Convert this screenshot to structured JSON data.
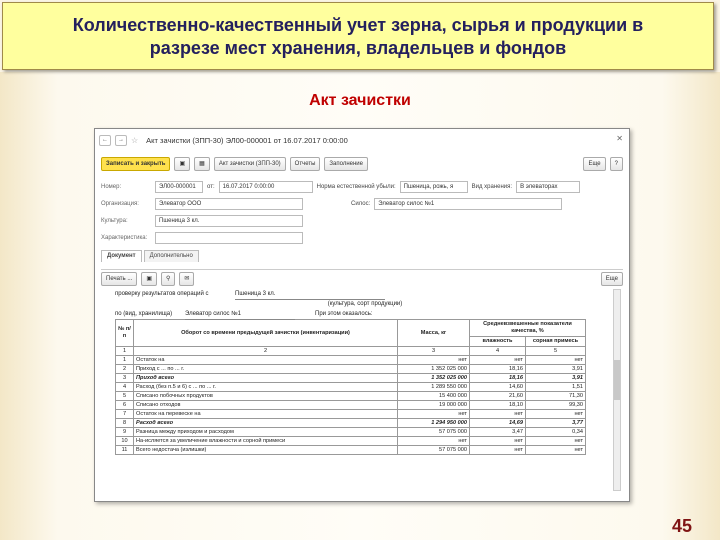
{
  "slide": {
    "title_line1": "Количественно-качественный учет зерна, сырья и продукции в",
    "title_line2": "разрезе мест хранения, владельцев и фондов",
    "heading": "Акт зачистки",
    "page_number": "45"
  },
  "window": {
    "title": "Акт зачистки (ЗПП-30) ЭЛ00-000001 от 16.07.2017 0:00:00",
    "toolbar": {
      "save_close": "Записать и закрыть",
      "print_act": "Акт зачистки (ЗПП-30)",
      "reports": "Отчеты",
      "fill": "Заполнение",
      "more": "Еще",
      "help": "?"
    },
    "fields": {
      "number_label": "Номер:",
      "number_value": "ЭЛ00-000001",
      "date_label": "от:",
      "date_value": "16.07.2017 0:00:00",
      "norm_label": "Норма естественной убыли:",
      "norm_value": "Пшеница, рожь, я",
      "storage_type_label": "Вид хранения:",
      "storage_type_value": "В элеваторах",
      "org_label": "Организация:",
      "org_value": "Элеватор ООО",
      "silo_label": "Силос:",
      "silo_value": "Элеватор силос №1",
      "culture_label": "Культура:",
      "culture_value": "Пшеница 3 кл.",
      "char_label": "Характеристика:",
      "char_value": ""
    },
    "tabs": [
      "Документ",
      "Дополнительно"
    ],
    "doc_toolbar": {
      "print": "Печать ...",
      "more": "Еще"
    },
    "report": {
      "check_label": "проверку результатов операций с",
      "check_value": "Пшеница 3 кл.",
      "culture_caption": "(культура, сорт продукции)",
      "place_label": "по (вид, хранилища)",
      "place_value": "Элеватор силос №1",
      "found_label": "При этом оказалось:",
      "headers": {
        "num": "№ п/п",
        "turnover": "Оборот со времени предыдущей зачистки (инвентаризации)",
        "mass": "Масса, кг",
        "quality": "Средневзвешенные показатели качества, %",
        "moisture": "влажность",
        "weed": "сорная примесь"
      },
      "col_numbers": [
        "1",
        "2",
        "3",
        "4",
        "5"
      ],
      "rows": [
        {
          "n": "1",
          "name": "Остаток на",
          "mass": "нет",
          "moist": "нет",
          "weed": "нет",
          "bold": false
        },
        {
          "n": "2",
          "name": "Приход с ... по ... г.",
          "mass": "1 352 025 000",
          "moist": "18,16",
          "weed": "3,91",
          "bold": false
        },
        {
          "n": "3",
          "name": "Приход всего",
          "mass": "1 352 025 000",
          "moist": "18,16",
          "weed": "3,91",
          "bold": true
        },
        {
          "n": "4",
          "name": "Расход (без п.5 и 6) с ... по ... г.",
          "mass": "1 289 550 000",
          "moist": "14,60",
          "weed": "1,51",
          "bold": false
        },
        {
          "n": "5",
          "name": "Списано побочных продуктов",
          "mass": "15 400 000",
          "moist": "21,60",
          "weed": "71,30",
          "bold": false
        },
        {
          "n": "6",
          "name": "Списано отходов",
          "mass": "19 000 000",
          "moist": "18,10",
          "weed": "99,30",
          "bold": false
        },
        {
          "n": "7",
          "name": "Остаток на перевеске на",
          "mass": "нет",
          "moist": "нет",
          "weed": "нет",
          "bold": false
        },
        {
          "n": "8",
          "name": "Расход всего",
          "mass": "1 294 950 000",
          "moist": "14,69",
          "weed": "3,77",
          "bold": true
        },
        {
          "n": "9",
          "name": "Разница между приходом и расходом",
          "mass": "57 075 000",
          "moist": "3,47",
          "weed": "0,34",
          "bold": false
        },
        {
          "n": "10",
          "name": "На-исляется за увеличение влажности и сорной примеси",
          "mass": "нет",
          "moist": "нет",
          "weed": "нет",
          "bold": false
        },
        {
          "n": "11",
          "name": "Всего недостача (излишки)",
          "mass": "57 075 000",
          "moist": "нет",
          "weed": "нет",
          "bold": false
        }
      ]
    }
  }
}
